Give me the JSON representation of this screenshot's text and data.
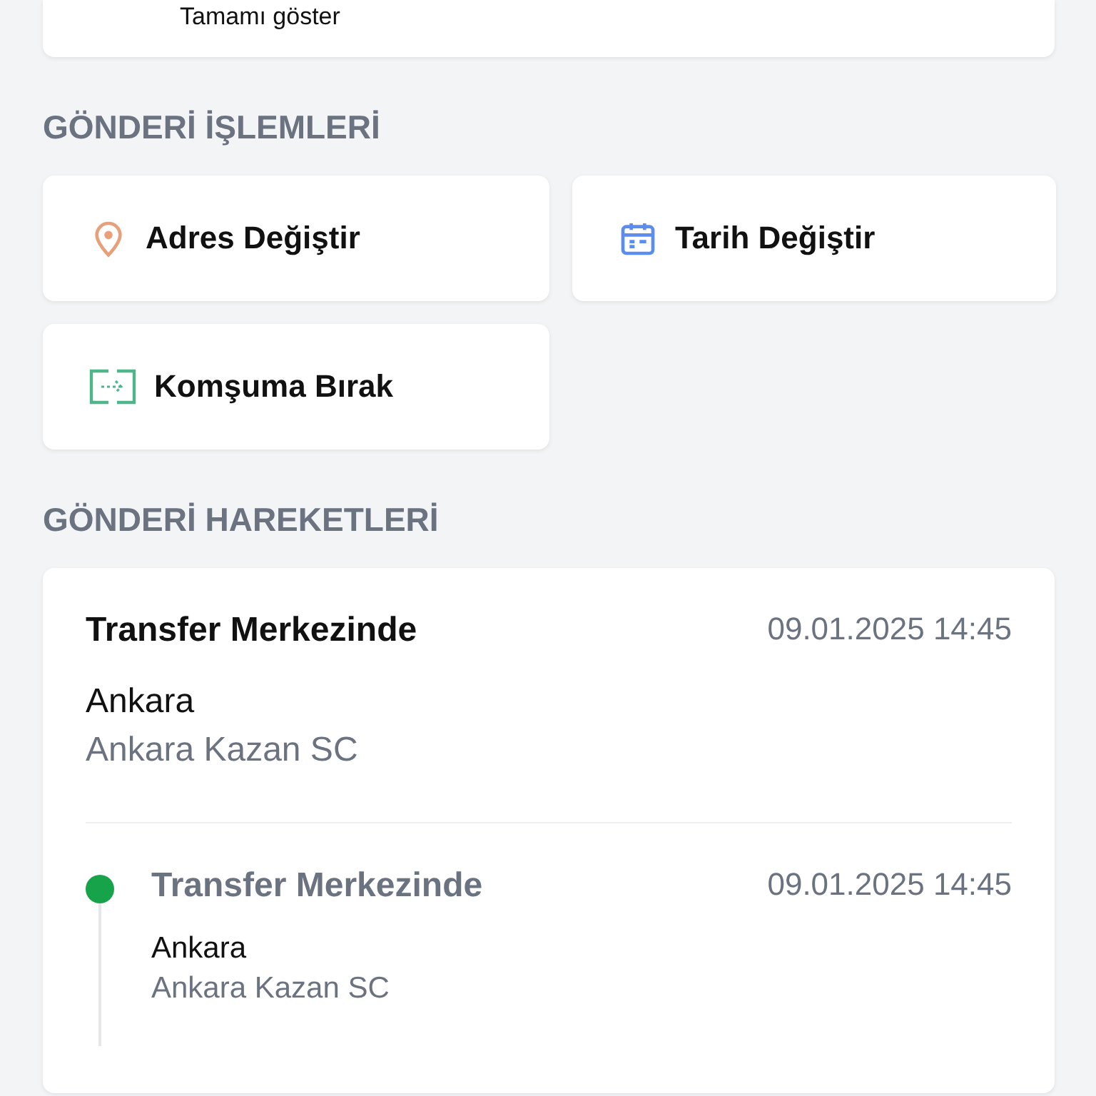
{
  "top_card": {
    "link": "Tamamı göster"
  },
  "actions_section": {
    "title": "GÖNDERİ İŞLEMLERİ",
    "actions": [
      {
        "kind": "pin",
        "label": "Adres Değiştir"
      },
      {
        "kind": "calendar",
        "label": "Tarih Değiştir"
      },
      {
        "kind": "swap",
        "label": "Komşuma Bırak"
      }
    ]
  },
  "movements_section": {
    "title": "GÖNDERİ HAREKETLERİ",
    "latest": {
      "status": "Transfer Merkezinde",
      "datetime": "09.01.2025 14:45",
      "city": "Ankara",
      "branch": "Ankara Kazan SC"
    },
    "timeline": [
      {
        "status": "Transfer Merkezinde",
        "datetime": "09.01.2025 14:45",
        "city": "Ankara",
        "branch": "Ankara Kazan SC",
        "color": "#16a34a"
      }
    ]
  }
}
